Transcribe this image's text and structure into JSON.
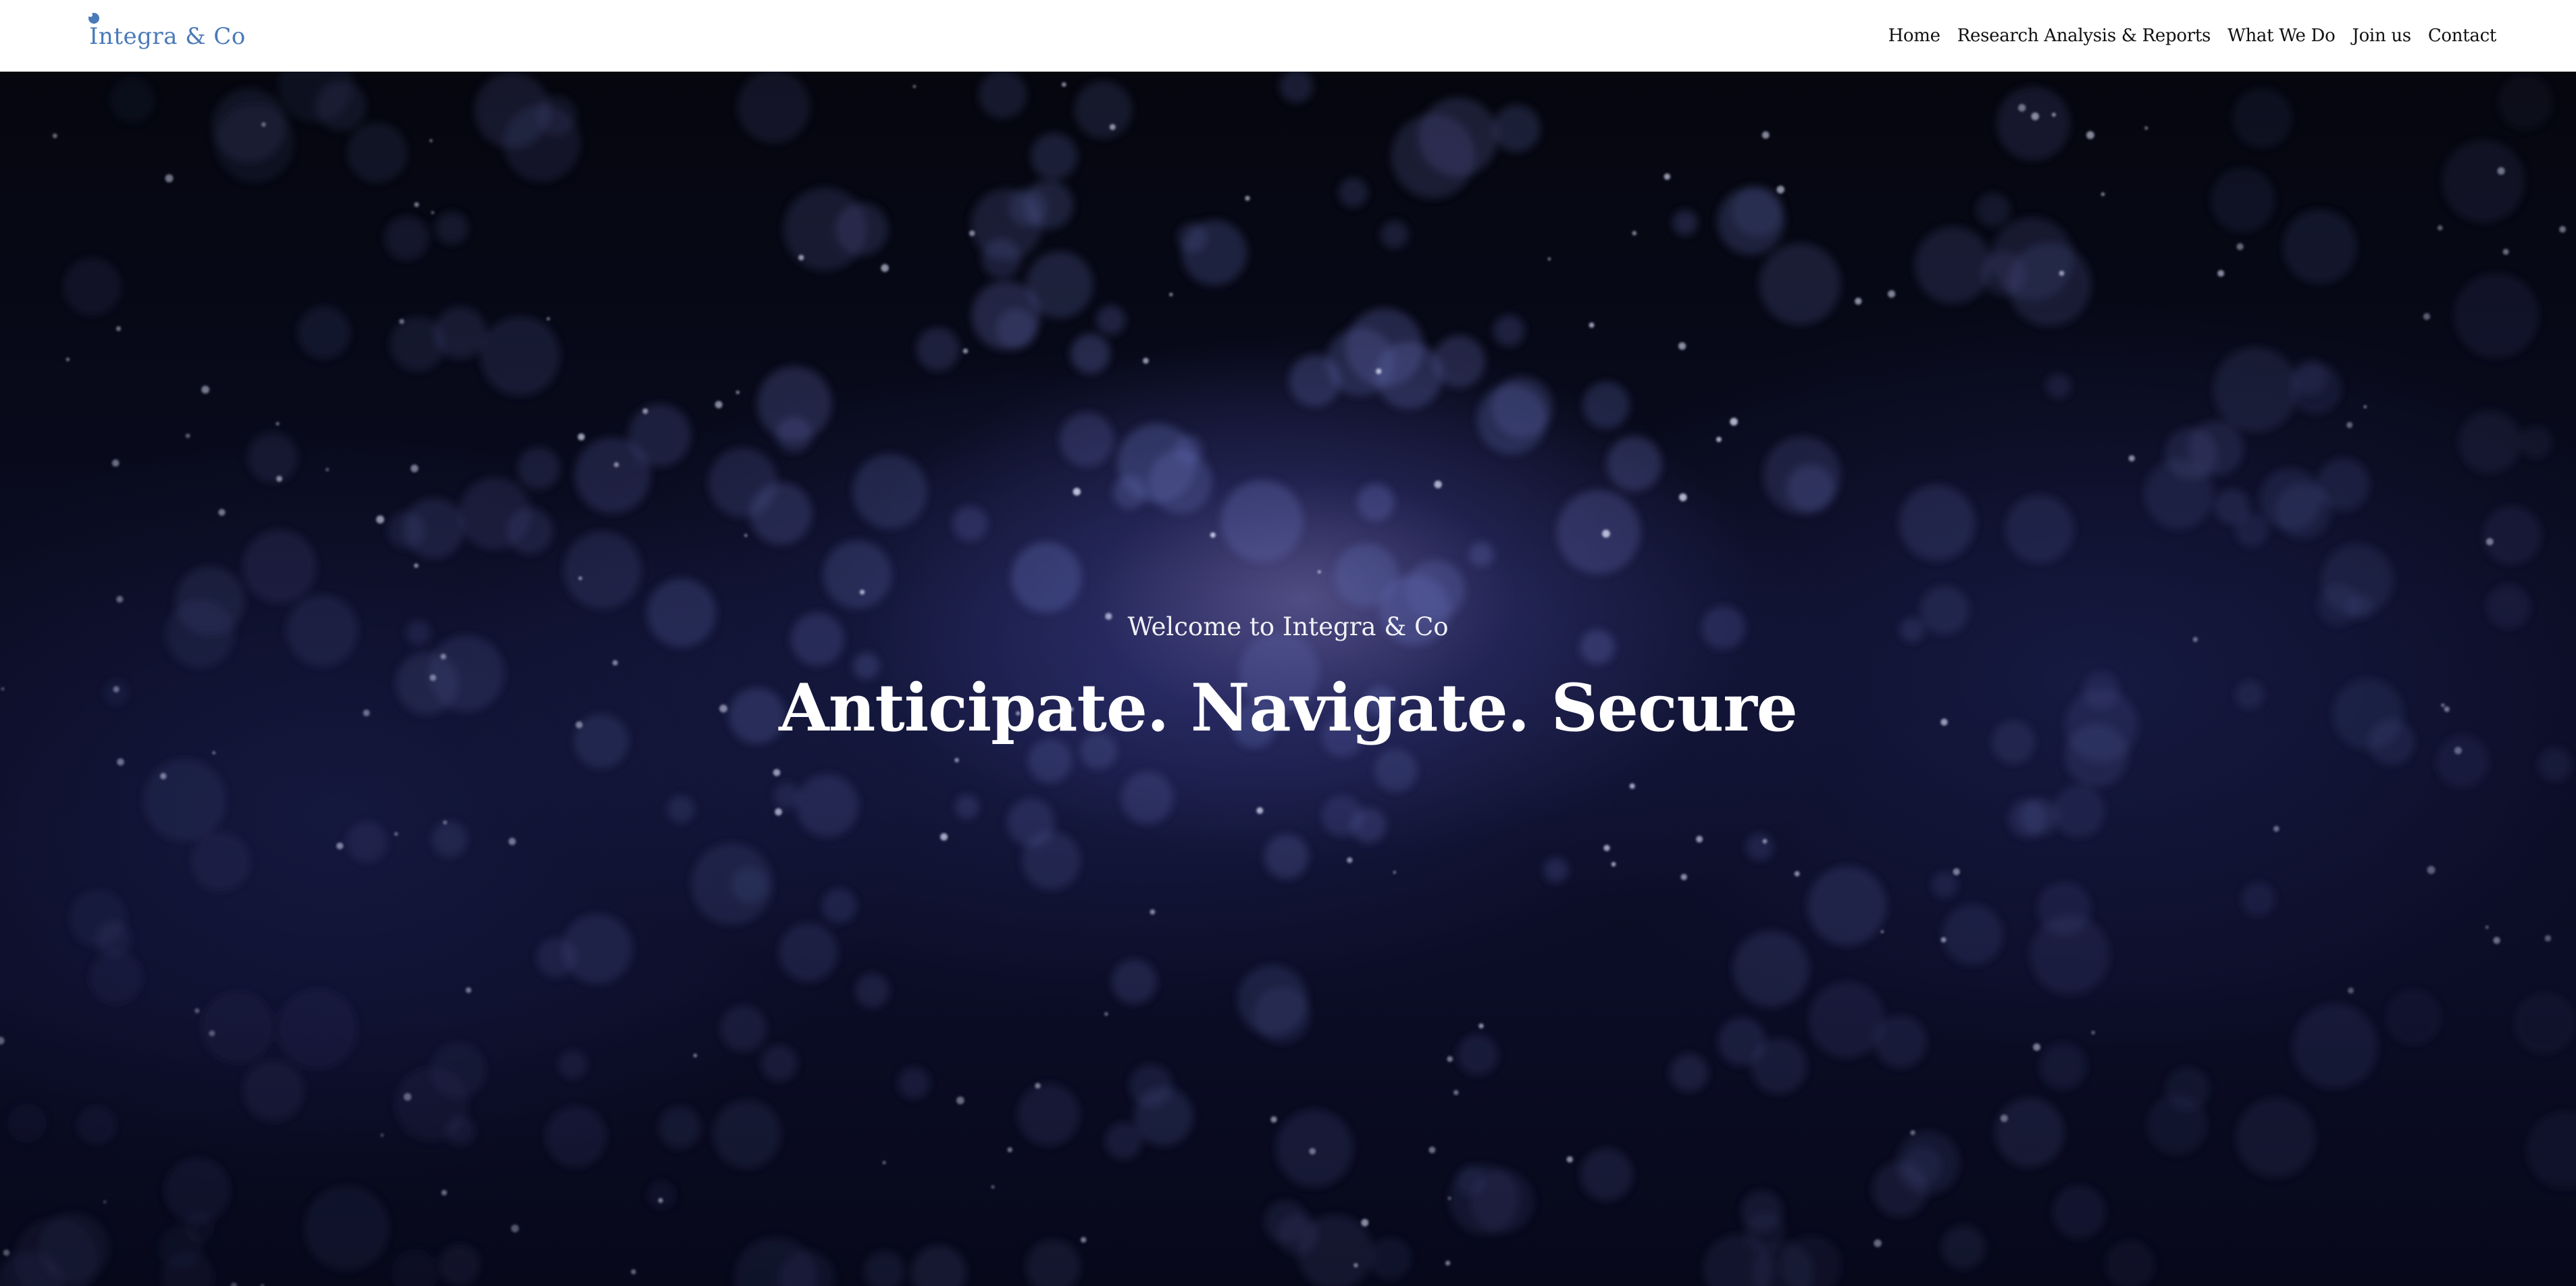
{
  "brand": {
    "name": "Integra & Co",
    "color": "#4a7ab8"
  },
  "nav": {
    "items": [
      {
        "label": "Home"
      },
      {
        "label": "Research Analysis & Reports"
      },
      {
        "label": "What We Do"
      },
      {
        "label": "Join us"
      },
      {
        "label": "Contact"
      }
    ]
  },
  "hero": {
    "eyebrow": "Welcome to Integra & Co",
    "title": "Anticipate. Navigate. Secure",
    "background": "bokeh-particles"
  },
  "colors": {
    "nav_bg": "#ffffff",
    "nav_text": "#111111",
    "hero_bg": "#0a0c22",
    "hero_text": "#ffffff"
  }
}
